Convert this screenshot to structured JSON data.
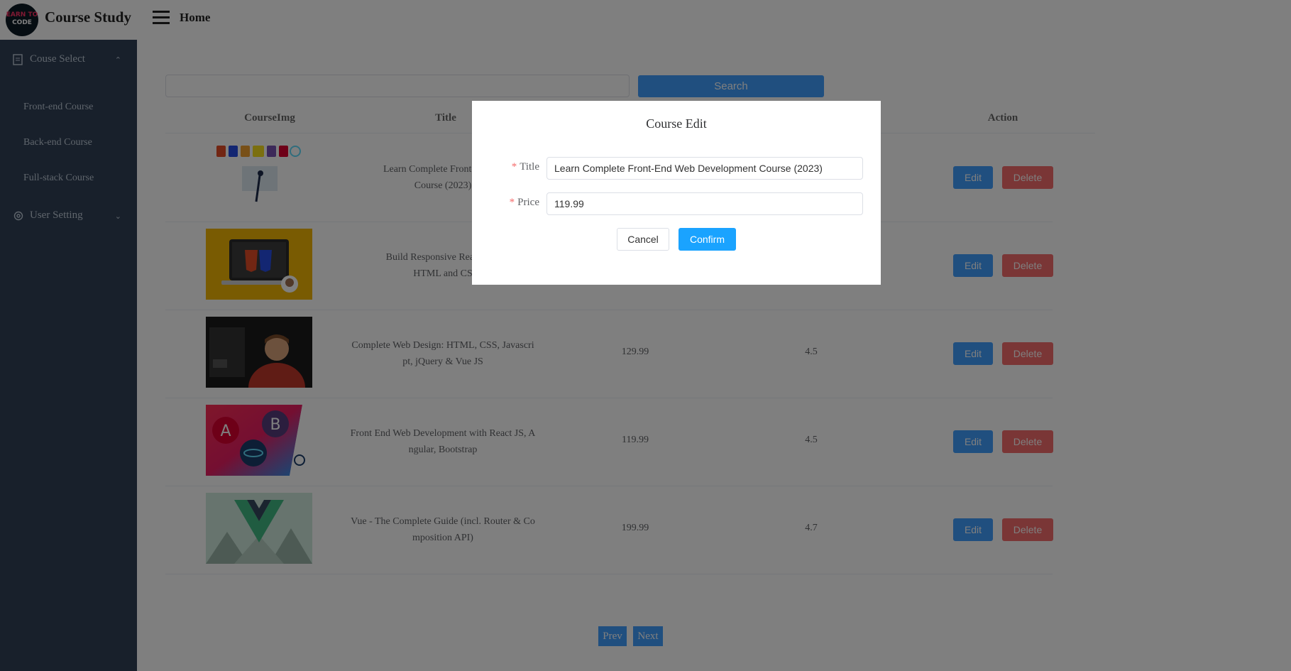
{
  "header": {
    "app_title": "Course Study",
    "logo_text_1": "EARN TO",
    "logo_text_2": "CODE",
    "nav_title": "Home"
  },
  "sidebar": {
    "groups": [
      {
        "label": "Couse Select",
        "icon": "document-icon",
        "expanded": true,
        "items": [
          {
            "label": "Front-end Course"
          },
          {
            "label": "Back-end Course"
          },
          {
            "label": "Full-stack Course"
          }
        ]
      },
      {
        "label": "User Setting",
        "icon": "gear-icon",
        "expanded": false
      }
    ]
  },
  "search": {
    "value": "",
    "button_label": "Search"
  },
  "table": {
    "columns": [
      "CourseImg",
      "Title",
      "Action"
    ],
    "rows": [
      {
        "title": "Learn Complete Front-End W\nCourse (2023)",
        "price": "",
        "rating": "",
        "image": "web-tech-logos"
      },
      {
        "title": "Build Responsive Real-Worl\nHTML and CS",
        "price": "",
        "rating": "",
        "image": "html5-css3-laptop"
      },
      {
        "title": "Complete Web Design: HTML, CSS, Javascri\npt, jQuery & Vue JS",
        "price": "129.99",
        "rating": "4.5",
        "image": "instructor-photo"
      },
      {
        "title": "Front End Web Development with React JS, A\nngular, Bootstrap",
        "price": "119.99",
        "rating": "4.5",
        "image": "angular-react-bootstrap"
      },
      {
        "title": "Vue - The Complete Guide (incl. Router & Co\nmposition API)",
        "price": "199.99",
        "rating": "4.7",
        "image": "vue-logo-mountains"
      }
    ],
    "edit_label": "Edit",
    "delete_label": "Delete"
  },
  "pagination": {
    "prev_label": "Prev",
    "next_label": "Next"
  },
  "dialog": {
    "title": "Course Edit",
    "title_label": "Title",
    "title_value": "Learn Complete Front-End Web Development Course (2023)",
    "price_label": "Price",
    "price_value": "119.99",
    "cancel_label": "Cancel",
    "confirm_label": "Confirm"
  },
  "colors": {
    "sidebar_bg": "#304156",
    "primary": "#409eff",
    "danger": "#f56c6c",
    "overlay": "rgba(0,0,0,0.5)"
  }
}
